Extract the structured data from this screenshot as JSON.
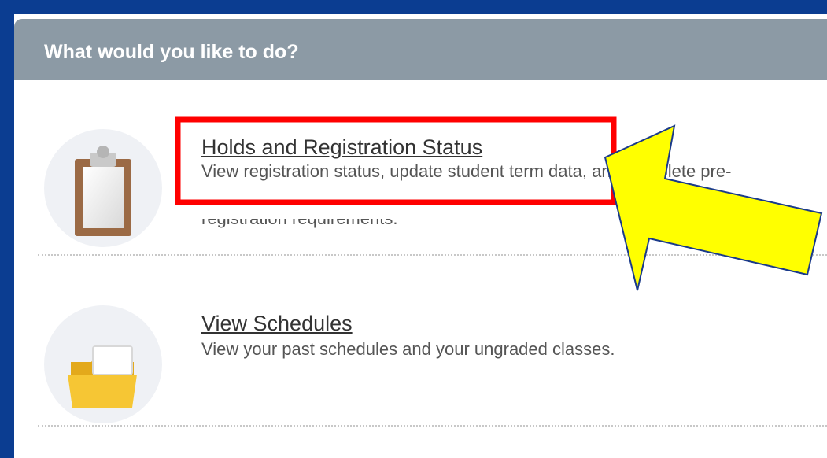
{
  "header": {
    "title": "What would you like to do?"
  },
  "items": [
    {
      "title": "Holds and Registration Status",
      "description_line1": "View registration status, update student term data, and complete pre-",
      "description_line2": "registration requirements.",
      "icon": "clipboard-icon"
    },
    {
      "title": "View Schedules",
      "description_line1": "View your past schedules and your ungraded classes.",
      "icon": "folder-icon"
    }
  ],
  "annotations": {
    "highlight_color": "#ff0000",
    "arrow_color": "#ffff00"
  },
  "colors": {
    "outer_frame": "#0b3d91",
    "header_bg": "#8c9aa5",
    "panel_bg": "#ffffff",
    "icon_circle": "#eff1f5",
    "folder": "#f6c634",
    "clipboard_board": "#9b6a45"
  }
}
